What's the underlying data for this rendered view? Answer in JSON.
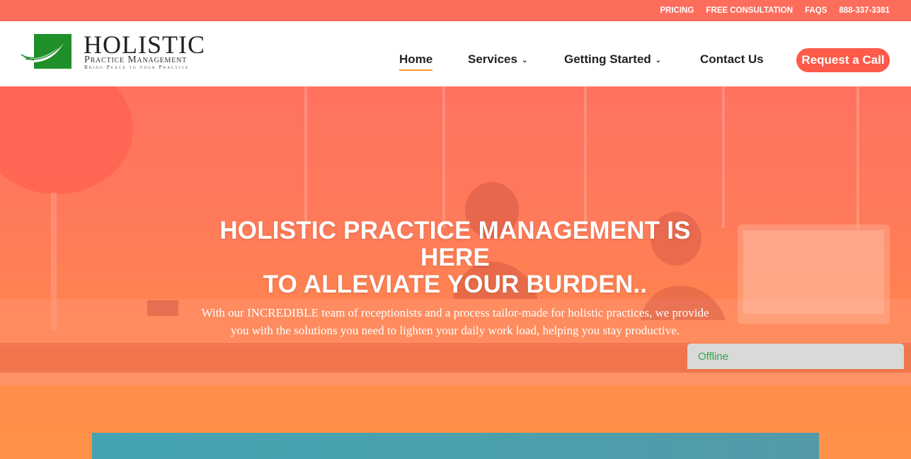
{
  "topbar": {
    "links": [
      "PRICING",
      "FREE CONSULTATION",
      "FAQS",
      "888-337-3381"
    ]
  },
  "logo": {
    "title": "HOLISTIC",
    "subtitle": "Practice Management",
    "tagline": "Bring Peace to your Practice"
  },
  "nav": {
    "home": "Home",
    "services": "Services",
    "getting_started": "Getting Started",
    "contact": "Contact Us",
    "cta": "Request a Call"
  },
  "hero": {
    "title_line1": "HOLISTIC PRACTICE MANAGEMENT IS HERE",
    "title_line2": "TO ALLEVIATE YOUR BURDEN..",
    "text": "With our INCREDIBLE team of receptionists and a process tailor-made for holistic practices, we provide you with the solutions you need to lighten your daily work load, helping you stay productive."
  },
  "chat": {
    "status": "Offline"
  },
  "colors": {
    "topbar": "#fd6d5b",
    "cta": "#fd5a4a",
    "nav_active": "#f79d2b",
    "brand_green": "#2e8b2e"
  }
}
